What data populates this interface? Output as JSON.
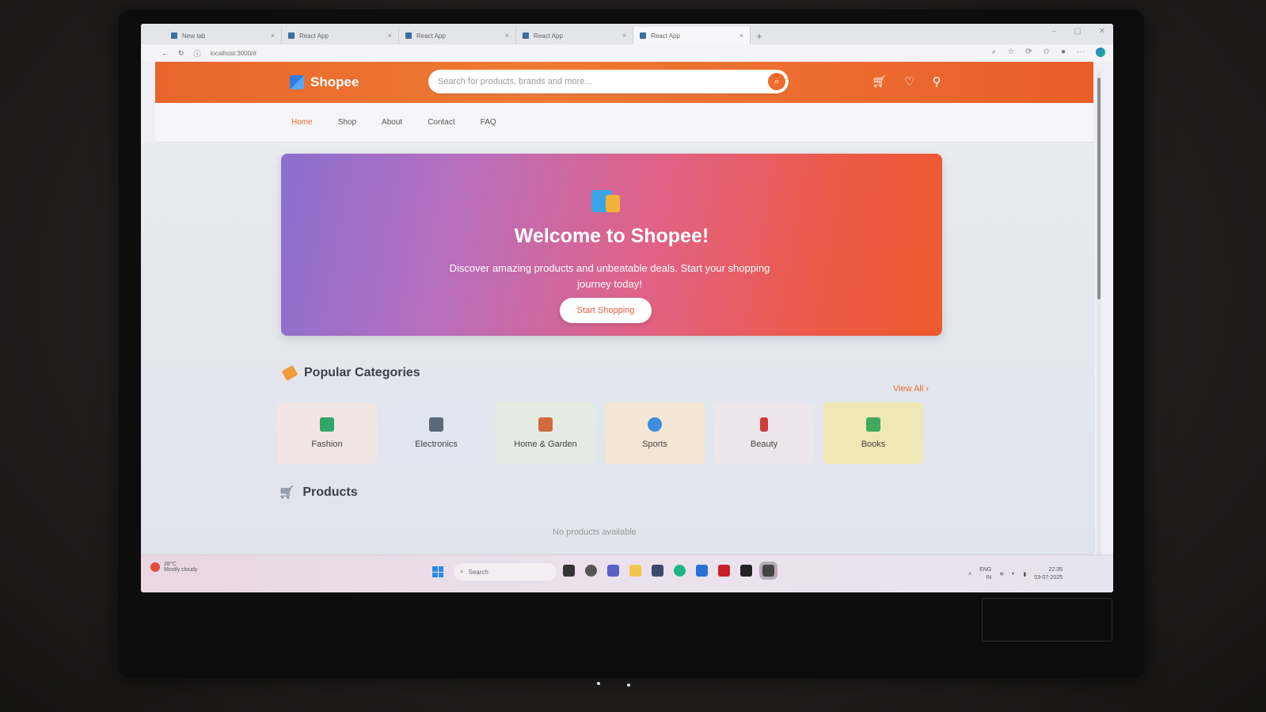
{
  "browser": {
    "tabs": [
      {
        "label": "New tab"
      },
      {
        "label": "React App"
      },
      {
        "label": "React App"
      },
      {
        "label": "React App"
      },
      {
        "label": "React App"
      }
    ],
    "new_tab": "+",
    "url": "localhost:3000/#"
  },
  "header": {
    "brand": "Shopee",
    "search_placeholder": "Search for products, brands and more...",
    "icons": [
      "cart-icon",
      "heart-icon",
      "user-icon"
    ]
  },
  "nav": {
    "items": [
      {
        "label": "Home",
        "active": true
      },
      {
        "label": "Shop"
      },
      {
        "label": "About"
      },
      {
        "label": "Contact"
      },
      {
        "label": "FAQ"
      }
    ]
  },
  "hero": {
    "title": "Welcome to Shopee!",
    "subtitle": "Discover amazing products and unbeatable deals. Start your shopping journey today!",
    "cta": "Start Shopping"
  },
  "categories": {
    "title": "Popular Categories",
    "view_all": "View All",
    "items": [
      {
        "label": "Fashion",
        "icon": "shirt-icon"
      },
      {
        "label": "Electronics",
        "icon": "phone-icon"
      },
      {
        "label": "Home & Garden",
        "icon": "house-icon"
      },
      {
        "label": "Sports",
        "icon": "ball-icon"
      },
      {
        "label": "Beauty",
        "icon": "lipstick-icon"
      },
      {
        "label": "Books",
        "icon": "books-icon"
      }
    ]
  },
  "products": {
    "title": "Products",
    "empty": "No products available"
  },
  "taskbar": {
    "weather_temp": "28°C",
    "weather_desc": "Mostly cloudy",
    "search": "Search",
    "lang": "ENG",
    "region": "IN",
    "time": "22:35",
    "date": "03-07-2025"
  },
  "colors": {
    "accent": "#ee6b2e",
    "hero_start": "#8a6fd0",
    "hero_end": "#ef5a2e"
  }
}
